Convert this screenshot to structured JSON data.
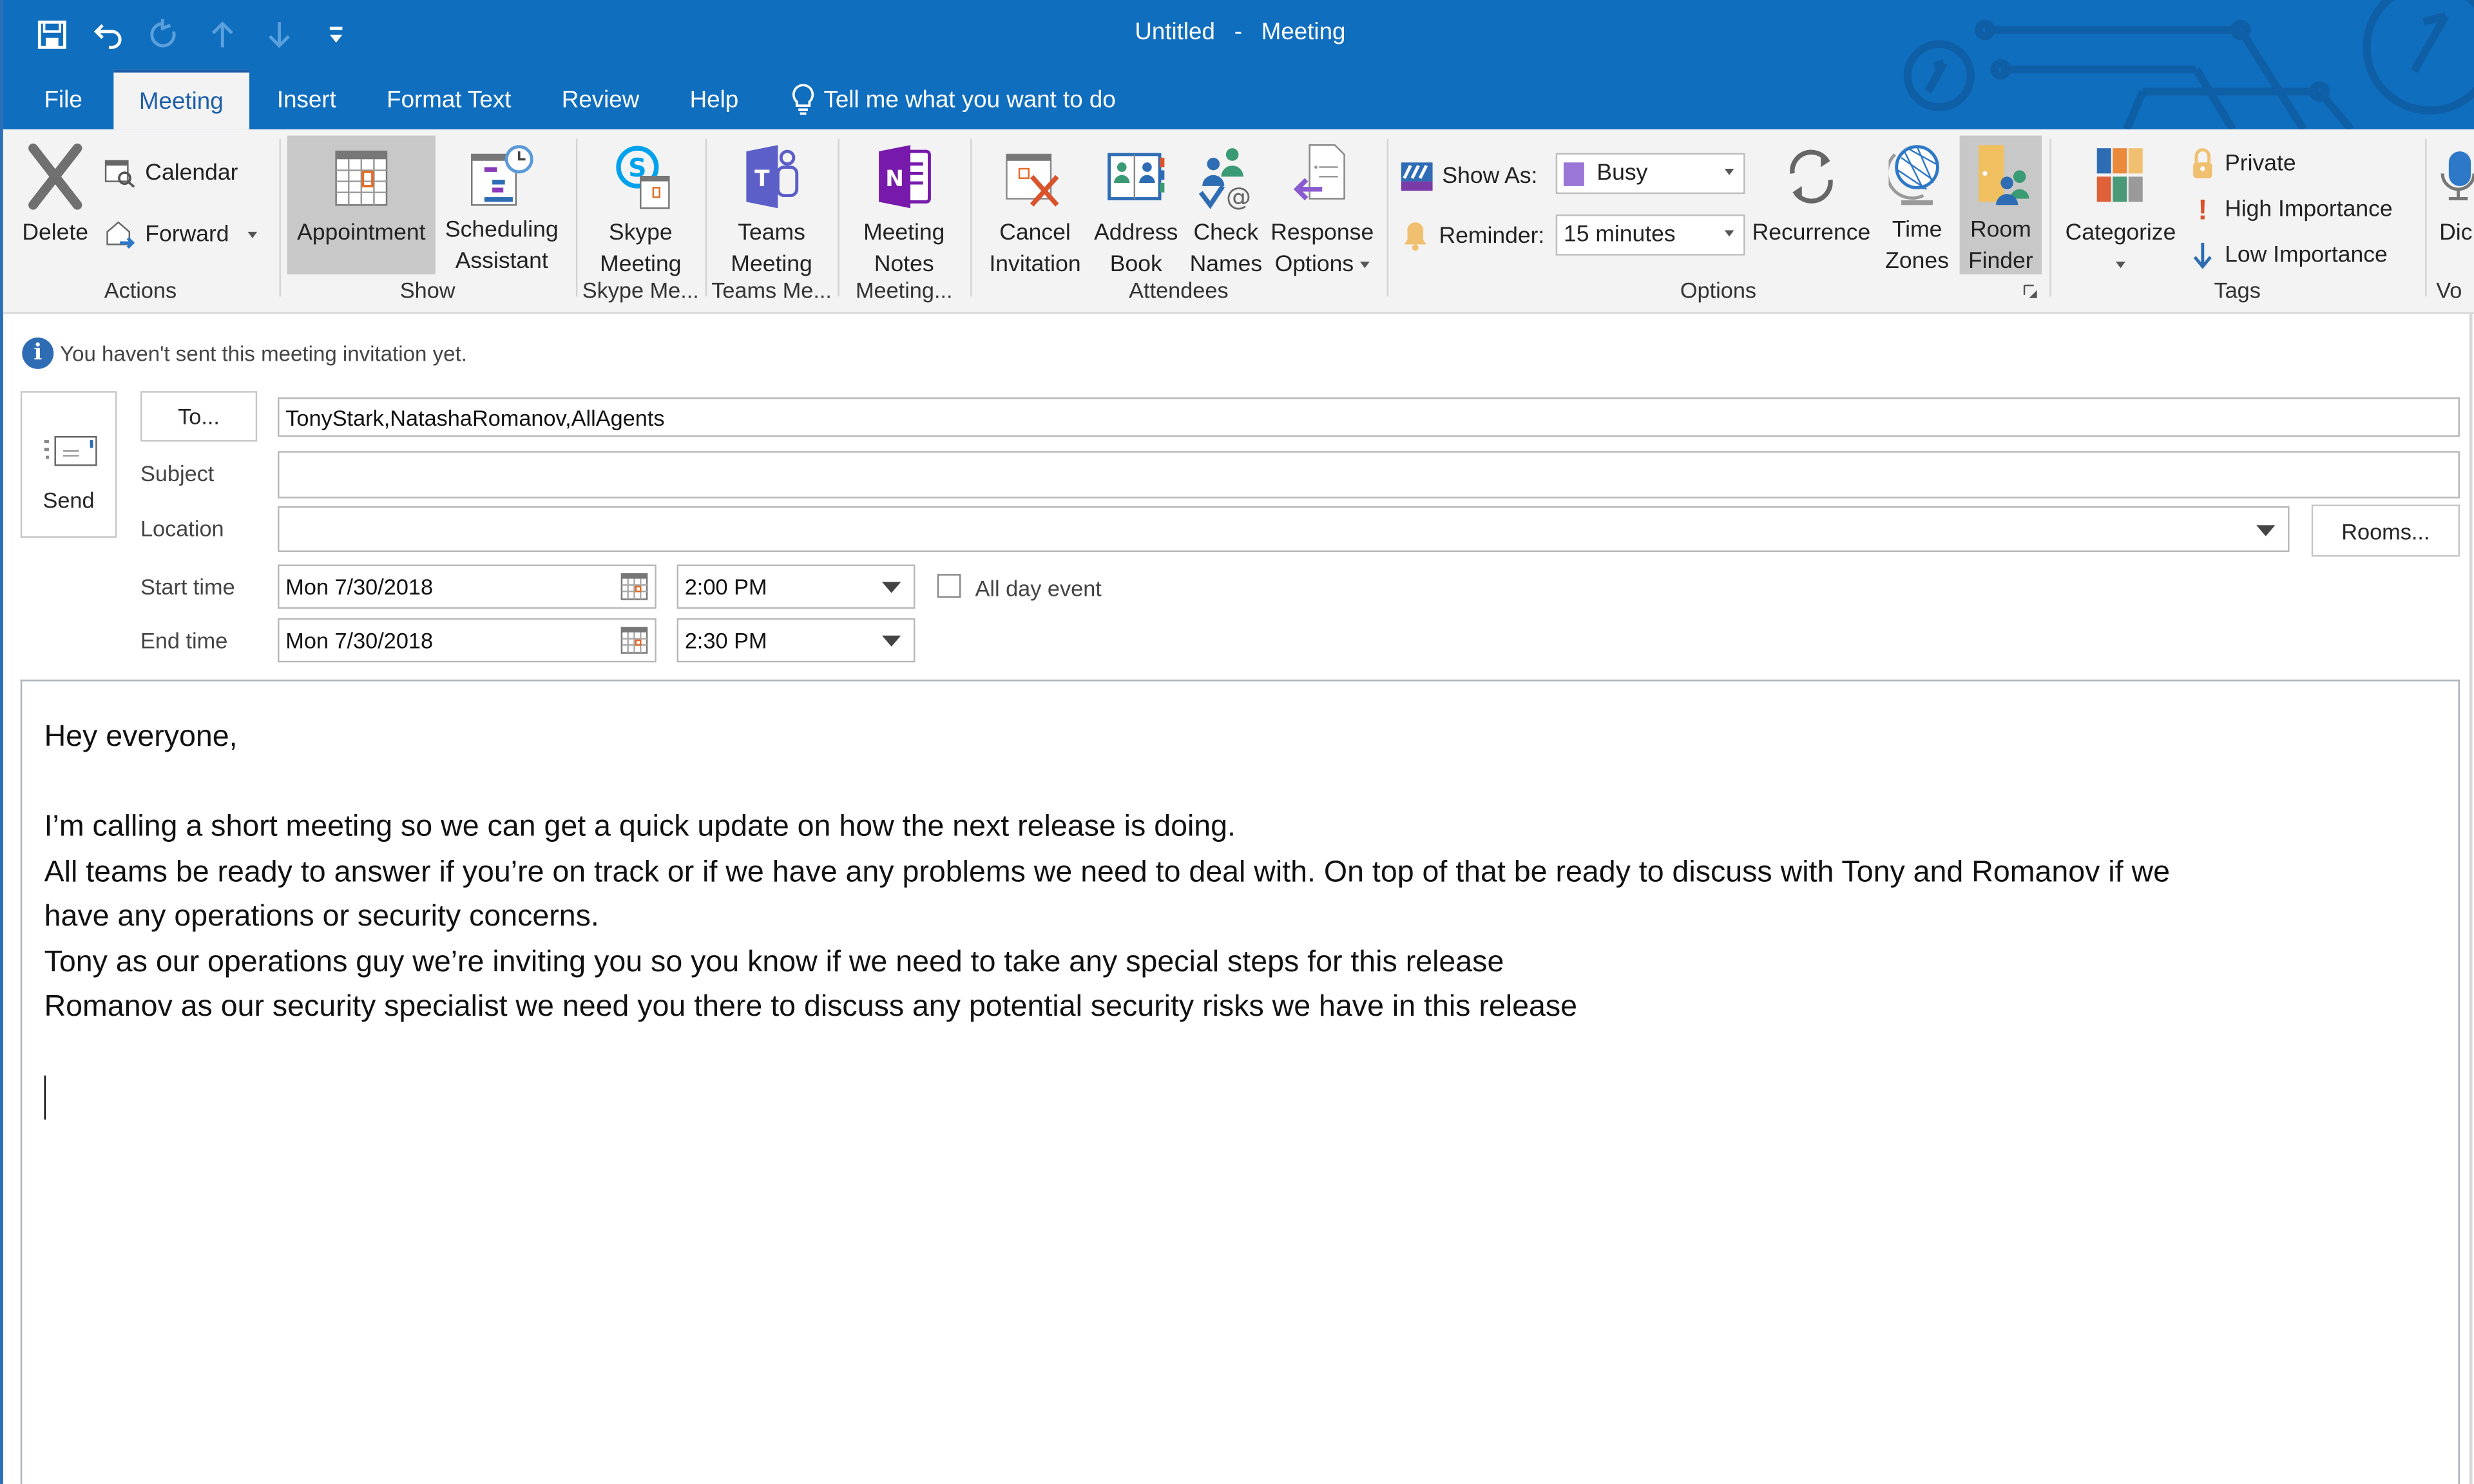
{
  "window": {
    "title_left": "Untitled",
    "title_sep": "-",
    "title_right": "Meeting"
  },
  "quick_access": [
    {
      "name": "save",
      "icon": "save-icon"
    },
    {
      "name": "undo",
      "icon": "undo-icon"
    },
    {
      "name": "redo",
      "icon": "redo-icon",
      "disabled": true
    },
    {
      "name": "previous-item",
      "icon": "arrow-up-icon",
      "disabled": true
    },
    {
      "name": "next-item",
      "icon": "arrow-down-icon",
      "disabled": true
    },
    {
      "name": "customize",
      "icon": "customize-qat-icon"
    }
  ],
  "tabs": [
    "File",
    "Meeting",
    "Insert",
    "Format Text",
    "Review",
    "Help"
  ],
  "active_tab": "Meeting",
  "tell_me": "Tell me what you want to do",
  "ribbon": {
    "actions": {
      "label": "Actions",
      "delete": "Delete",
      "calendar": "Calendar",
      "forward": "Forward"
    },
    "show": {
      "label": "Show",
      "appointment": "Appointment",
      "scheduling_1": "Scheduling",
      "scheduling_2": "Assistant"
    },
    "skype": {
      "label": "Skype Me...",
      "btn_1": "Skype",
      "btn_2": "Meeting"
    },
    "teams": {
      "label": "Teams Me...",
      "btn_1": "Teams",
      "btn_2": "Meeting"
    },
    "meeting_notes": {
      "label": "Meeting...",
      "btn_1": "Meeting",
      "btn_2": "Notes"
    },
    "attendees": {
      "label": "Attendees",
      "cancel_1": "Cancel",
      "cancel_2": "Invitation",
      "address_1": "Address",
      "address_2": "Book",
      "check_1": "Check",
      "check_2": "Names",
      "response_1": "Response",
      "response_2": "Options"
    },
    "options": {
      "label": "Options",
      "show_as_label": "Show As:",
      "show_as_value": "Busy",
      "show_as_color": "#9a76d6",
      "reminder_label": "Reminder:",
      "reminder_value": "15 minutes",
      "recurrence": "Recurrence",
      "time_zones_1": "Time",
      "time_zones_2": "Zones",
      "room_finder_1": "Room",
      "room_finder_2": "Finder"
    },
    "tags": {
      "label": "Tags",
      "categorize": "Categorize",
      "private": "Private",
      "high": "High Importance",
      "low": "Low Importance"
    },
    "voice": {
      "label": "Vo",
      "dictate": "Dic"
    }
  },
  "infobar": "You haven't sent this meeting invitation yet.",
  "form": {
    "send": "Send",
    "to_button": "To...",
    "to_value": "TonyStark,NatashaRomanov,AllAgents",
    "subject_label": "Subject",
    "subject_value": "",
    "location_label": "Location",
    "location_value": "",
    "rooms_button": "Rooms...",
    "start_label": "Start time",
    "start_date": "Mon 7/30/2018",
    "start_time": "2:00 PM",
    "all_day_label": "All day event",
    "all_day_checked": false,
    "end_label": "End time",
    "end_date": "Mon 7/30/2018",
    "end_time": "2:30 PM"
  },
  "body": {
    "lines": [
      "Hey everyone,",
      "",
      "I’m calling a short meeting so we can get a quick update on how the next release is doing.",
      "All teams be ready to answer if you’re on track or if we have any problems we need to deal with. On top of that be ready to discuss with Tony and Romanov if we",
      "have any operations or security concerns.",
      "Tony as our operations guy we’re inviting you so you know if we need to take any special steps for this release",
      "Romanov as our security specialist we need you there to discuss any potential security risks we have in this release"
    ]
  },
  "colors": {
    "titlebar": "#106ebe",
    "ribbon_bg": "#f3f3f3",
    "active_tab_text": "#1e5fa9",
    "selected_button": "#c8c8c8"
  }
}
